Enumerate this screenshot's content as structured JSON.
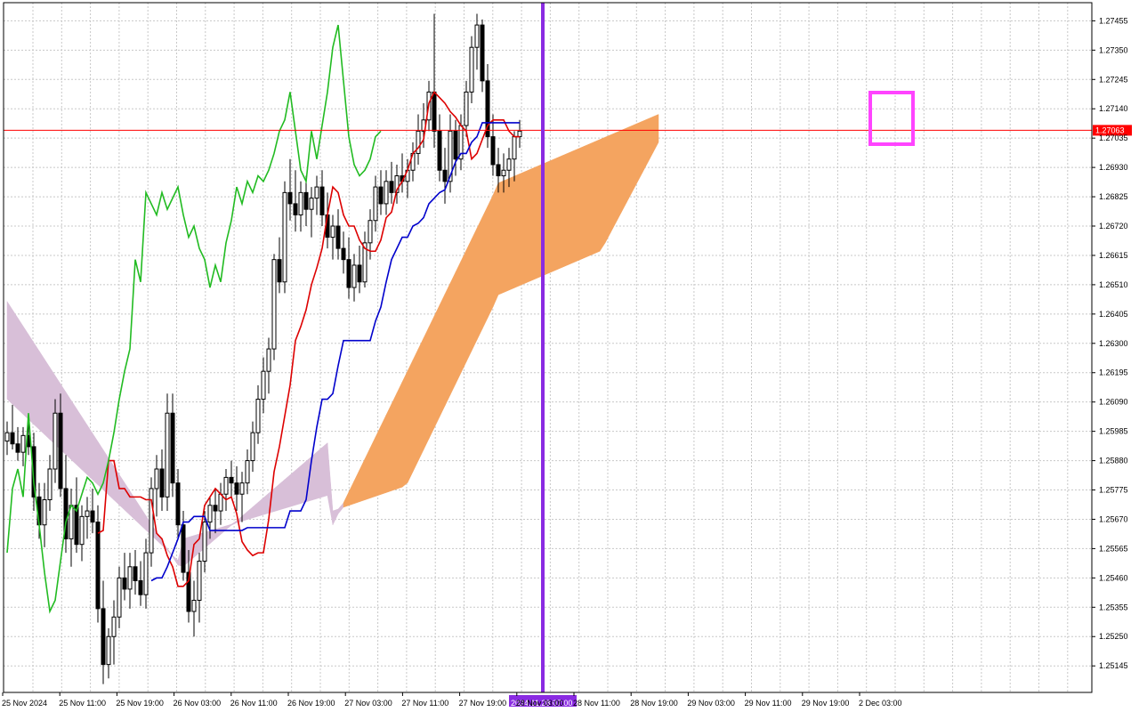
{
  "chart_data": {
    "type": "candlestick",
    "instrument_note": "",
    "y_ticks": [
      "1.27455",
      "1.27350",
      "1.27245",
      "1.27140",
      "1.27035",
      "1.26930",
      "1.26825",
      "1.26720",
      "1.26615",
      "1.26510",
      "1.26405",
      "1.26300",
      "1.26195",
      "1.26090",
      "1.25985",
      "1.25880",
      "1.25775",
      "1.25670",
      "1.25565",
      "1.25460",
      "1.25355",
      "1.25250",
      "1.25145"
    ],
    "x_ticks": [
      "25 Nov 2024",
      "25 Nov 11:00",
      "25 Nov 19:00",
      "26 Nov 03:00",
      "26 Nov 11:00",
      "26 Nov 19:00",
      "27 Nov 03:00",
      "27 Nov 11:00",
      "27 Nov 19:00",
      "28 Nov 03:00",
      "28 Nov 11:00",
      "28 Nov 19:00",
      "29 Nov 03:00",
      "29 Nov 11:00",
      "29 Nov 19:00",
      "2 Dec 03:00"
    ],
    "ylim": [
      1.2505,
      1.2752
    ],
    "grid": true,
    "current_price": {
      "label": "1.27063",
      "value": 1.27063,
      "color": "#ff0000"
    },
    "vertical_marker": {
      "label": "2024.11.28 07:00",
      "color": "#8a2be2"
    },
    "highlight_box_color": "#ff44ff",
    "colors": {
      "tenkan": "#dd0000",
      "kijun": "#0000cc",
      "chikou": "#22bb22",
      "cloud_bull": "#f4a460",
      "cloud_bear": "#d8bfd8",
      "candle": "#000000",
      "grid": "#c8c8c8"
    },
    "candles": [
      [
        1.2595,
        1.2602,
        1.259,
        1.2598
      ],
      [
        1.2598,
        1.2608,
        1.2592,
        1.2594
      ],
      [
        1.2594,
        1.26,
        1.2588,
        1.2591
      ],
      [
        1.2591,
        1.26,
        1.2586,
        1.2597
      ],
      [
        1.2597,
        1.2602,
        1.259,
        1.2593
      ],
      [
        1.2593,
        1.2598,
        1.257,
        1.2575
      ],
      [
        1.2575,
        1.258,
        1.256,
        1.2565
      ],
      [
        1.2565,
        1.258,
        1.2557,
        1.2574
      ],
      [
        1.2574,
        1.259,
        1.257,
        1.2585
      ],
      [
        1.2585,
        1.261,
        1.258,
        1.2605
      ],
      [
        1.2605,
        1.2612,
        1.2575,
        1.2578
      ],
      [
        1.2578,
        1.259,
        1.2555,
        1.256
      ],
      [
        1.256,
        1.2578,
        1.255,
        1.2572
      ],
      [
        1.2572,
        1.2582,
        1.2555,
        1.2558
      ],
      [
        1.2558,
        1.2572,
        1.2552,
        1.2568
      ],
      [
        1.2568,
        1.2575,
        1.256,
        1.257
      ],
      [
        1.257,
        1.2578,
        1.2562,
        1.2566
      ],
      [
        1.2566,
        1.2572,
        1.253,
        1.2535
      ],
      [
        1.2535,
        1.2545,
        1.2508,
        1.2515
      ],
      [
        1.2515,
        1.2528,
        1.251,
        1.2525
      ],
      [
        1.2525,
        1.2538,
        1.2515,
        1.2532
      ],
      [
        1.2532,
        1.255,
        1.2528,
        1.2546
      ],
      [
        1.2546,
        1.2555,
        1.2538,
        1.2542
      ],
      [
        1.2542,
        1.2555,
        1.2535,
        1.255
      ],
      [
        1.255,
        1.2556,
        1.254,
        1.2545
      ],
      [
        1.2545,
        1.2552,
        1.2536,
        1.254
      ],
      [
        1.254,
        1.256,
        1.2535,
        1.2555
      ],
      [
        1.2555,
        1.2582,
        1.255,
        1.2578
      ],
      [
        1.2578,
        1.259,
        1.2568,
        1.2585
      ],
      [
        1.2585,
        1.2592,
        1.257,
        1.2575
      ],
      [
        1.2575,
        1.2612,
        1.257,
        1.2605
      ],
      [
        1.2605,
        1.2612,
        1.2575,
        1.258
      ],
      [
        1.258,
        1.2585,
        1.256,
        1.2565
      ],
      [
        1.2565,
        1.257,
        1.2545,
        1.2548
      ],
      [
        1.2548,
        1.2556,
        1.253,
        1.2534
      ],
      [
        1.2534,
        1.2545,
        1.2525,
        1.2538
      ],
      [
        1.2538,
        1.2555,
        1.253,
        1.2552
      ],
      [
        1.2552,
        1.257,
        1.2548,
        1.2566
      ],
      [
        1.2566,
        1.2575,
        1.256,
        1.2572
      ],
      [
        1.2572,
        1.2578,
        1.2562,
        1.257
      ],
      [
        1.257,
        1.258,
        1.2565,
        1.2576
      ],
      [
        1.2576,
        1.2585,
        1.257,
        1.2582
      ],
      [
        1.2582,
        1.2588,
        1.2575,
        1.258
      ],
      [
        1.258,
        1.2586,
        1.257,
        1.2576
      ],
      [
        1.2576,
        1.2584,
        1.2566,
        1.258
      ],
      [
        1.258,
        1.2592,
        1.2576,
        1.2588
      ],
      [
        1.2588,
        1.2602,
        1.2584,
        1.2598
      ],
      [
        1.2598,
        1.2615,
        1.2594,
        1.261
      ],
      [
        1.261,
        1.2625,
        1.2605,
        1.262
      ],
      [
        1.262,
        1.2632,
        1.2612,
        1.2628
      ],
      [
        1.2628,
        1.2662,
        1.2624,
        1.266
      ],
      [
        1.266,
        1.2668,
        1.2648,
        1.2652
      ],
      [
        1.2652,
        1.2688,
        1.2648,
        1.2684
      ],
      [
        1.2684,
        1.2696,
        1.2674,
        1.268
      ],
      [
        1.268,
        1.2692,
        1.267,
        1.2676
      ],
      [
        1.2676,
        1.2688,
        1.267,
        1.2684
      ],
      [
        1.2684,
        1.269,
        1.2672,
        1.2678
      ],
      [
        1.2678,
        1.2686,
        1.2668,
        1.2682
      ],
      [
        1.2682,
        1.269,
        1.2676,
        1.2686
      ],
      [
        1.2686,
        1.2692,
        1.2672,
        1.2676
      ],
      [
        1.2676,
        1.2684,
        1.2664,
        1.2668
      ],
      [
        1.2668,
        1.2676,
        1.266,
        1.2672
      ],
      [
        1.2672,
        1.2678,
        1.266,
        1.2664
      ],
      [
        1.2664,
        1.267,
        1.2655,
        1.266
      ],
      [
        1.266,
        1.2668,
        1.2646,
        1.265
      ],
      [
        1.265,
        1.2662,
        1.2645,
        1.2658
      ],
      [
        1.2658,
        1.2665,
        1.2648,
        1.2652
      ],
      [
        1.2652,
        1.267,
        1.265,
        1.2666
      ],
      [
        1.2666,
        1.2678,
        1.266,
        1.2674
      ],
      [
        1.2674,
        1.269,
        1.267,
        1.2686
      ],
      [
        1.2686,
        1.2692,
        1.2676,
        1.268
      ],
      [
        1.268,
        1.2692,
        1.2676,
        1.2688
      ],
      [
        1.2688,
        1.2695,
        1.268,
        1.2684
      ],
      [
        1.2684,
        1.2694,
        1.268,
        1.269
      ],
      [
        1.269,
        1.2698,
        1.2684,
        1.2688
      ],
      [
        1.2688,
        1.2696,
        1.2682,
        1.2692
      ],
      [
        1.2692,
        1.2702,
        1.2688,
        1.2698
      ],
      [
        1.2698,
        1.2712,
        1.2694,
        1.2706
      ],
      [
        1.2706,
        1.2716,
        1.27,
        1.271
      ],
      [
        1.271,
        1.2724,
        1.2706,
        1.272
      ],
      [
        1.272,
        1.2748,
        1.27,
        1.2706
      ],
      [
        1.2706,
        1.2712,
        1.2688,
        1.2692
      ],
      [
        1.2692,
        1.27,
        1.268,
        1.2688
      ],
      [
        1.2688,
        1.2712,
        1.2684,
        1.2706
      ],
      [
        1.2706,
        1.271,
        1.269,
        1.2696
      ],
      [
        1.2696,
        1.2712,
        1.2692,
        1.2708
      ],
      [
        1.2708,
        1.2724,
        1.2704,
        1.272
      ],
      [
        1.272,
        1.274,
        1.2716,
        1.2736
      ],
      [
        1.2736,
        1.2748,
        1.2728,
        1.2744
      ],
      [
        1.2744,
        1.2746,
        1.272,
        1.2724
      ],
      [
        1.2724,
        1.273,
        1.27,
        1.2704
      ],
      [
        1.2704,
        1.2712,
        1.269,
        1.2694
      ],
      [
        1.2694,
        1.27,
        1.2684,
        1.269
      ],
      [
        1.269,
        1.2698,
        1.2684,
        1.2692
      ],
      [
        1.2692,
        1.27,
        1.2686,
        1.2696
      ],
      [
        1.2696,
        1.2706,
        1.2688,
        1.2704
      ],
      [
        1.2704,
        1.271,
        1.27,
        1.2706
      ]
    ],
    "tenkan": [
      1.2562,
      1.2563,
      1.2588,
      1.2588,
      1.2578,
      1.2578,
      1.2575,
      1.2575,
      1.2575,
      1.2574,
      1.2574,
      1.2562,
      1.256,
      1.2554,
      1.255,
      1.2543,
      1.2543,
      1.2545,
      1.2558,
      1.256,
      1.2572,
      1.2575,
      1.2578,
      1.2576,
      1.2574,
      1.2575,
      1.2569,
      1.2559,
      1.2556,
      1.2554,
      1.2555,
      1.2555,
      1.2567,
      1.2584,
      1.2593,
      1.2604,
      1.2615,
      1.2631,
      1.2636,
      1.2642,
      1.2651,
      1.2657,
      1.2664,
      1.2676,
      1.2686,
      1.2684,
      1.2676,
      1.2672,
      1.2672,
      1.2667,
      1.2664,
      1.2663,
      1.2663,
      1.2667,
      1.2675,
      1.2677,
      1.2685,
      1.2688,
      1.2692,
      1.2698,
      1.27,
      1.2703,
      1.2716,
      1.272,
      1.2718,
      1.2716,
      1.2713,
      1.2711,
      1.2708,
      1.2706,
      1.2696,
      1.2698,
      1.2703,
      1.2708,
      1.271,
      1.271,
      1.271,
      1.2706,
      1.2704,
      1.2704
    ],
    "kijun": [
      1.2545,
      1.2546,
      1.2546,
      1.255,
      1.2555,
      1.256,
      1.2566,
      1.2566,
      1.2568,
      1.2568,
      1.2568,
      1.2563,
      1.2563,
      1.2563,
      1.2563,
      1.2563,
      1.2563,
      1.2563,
      1.2564,
      1.2564,
      1.2564,
      1.2564,
      1.2564,
      1.2564,
      1.2564,
      1.2564,
      1.257,
      1.257,
      1.257,
      1.2574,
      1.2588,
      1.26,
      1.261,
      1.261,
      1.2612,
      1.2622,
      1.2631,
      1.2631,
      1.2631,
      1.2631,
      1.2631,
      1.2631,
      1.2638,
      1.2643,
      1.2652,
      1.266,
      1.2664,
      1.2668,
      1.2668,
      1.2672,
      1.2673,
      1.2675,
      1.268,
      1.2682,
      1.2684,
      1.2685,
      1.269,
      1.2695,
      1.2698,
      1.2698,
      1.2702,
      1.2704,
      1.2709,
      1.2709,
      1.2709,
      1.2709,
      1.2709,
      1.2709,
      1.2709,
      1.2709
    ]
  }
}
